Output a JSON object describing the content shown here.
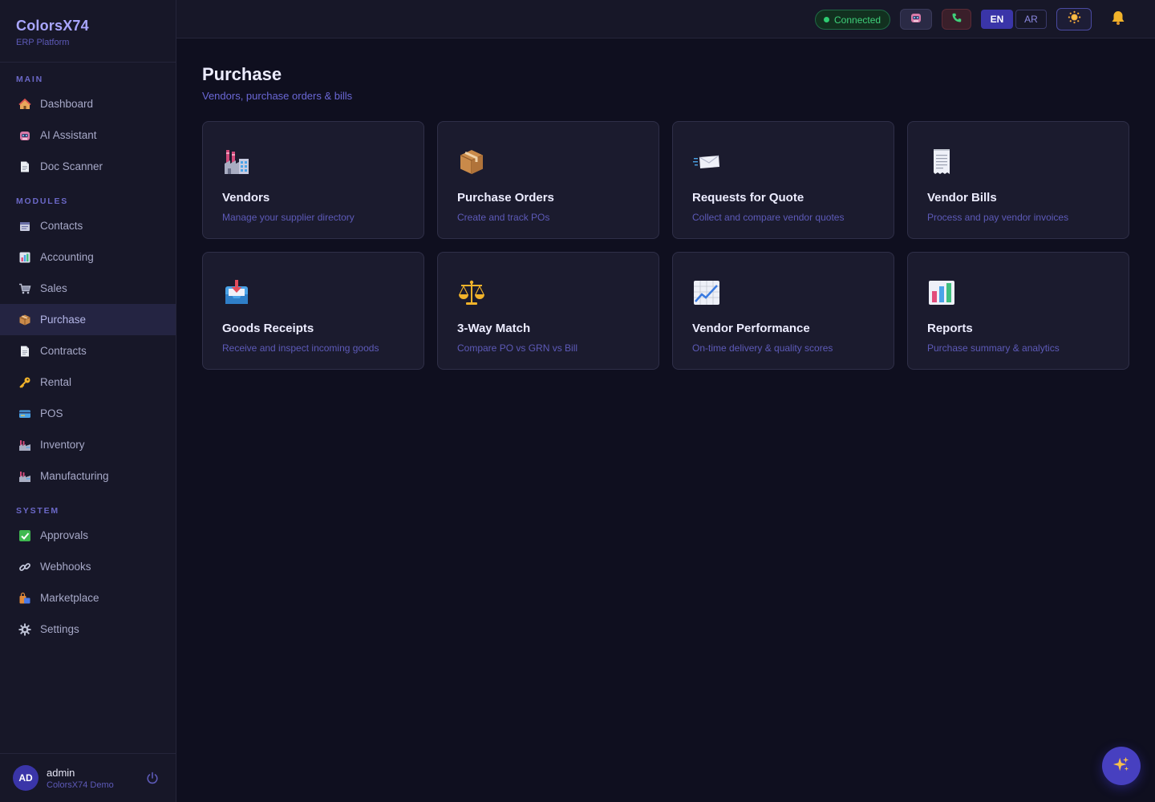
{
  "brand": {
    "name": "ColorsX74",
    "subtitle": "ERP Platform"
  },
  "sidebar": {
    "sections": {
      "main": "MAIN",
      "modules": "MODULES",
      "system": "SYSTEM"
    },
    "main_items": [
      {
        "label": "Dashboard",
        "icon": "house-icon"
      },
      {
        "label": "AI Assistant",
        "icon": "robot-icon"
      },
      {
        "label": "Doc Scanner",
        "icon": "document-icon"
      }
    ],
    "module_items": [
      {
        "label": "Contacts",
        "icon": "card-index-icon"
      },
      {
        "label": "Accounting",
        "icon": "bar-chart-icon"
      },
      {
        "label": "Sales",
        "icon": "cart-icon"
      },
      {
        "label": "Purchase",
        "icon": "package-icon",
        "active": true
      },
      {
        "label": "Contracts",
        "icon": "document-icon"
      },
      {
        "label": "Rental",
        "icon": "key-icon"
      },
      {
        "label": "POS",
        "icon": "credit-card-icon"
      },
      {
        "label": "Inventory",
        "icon": "factory-icon"
      },
      {
        "label": "Manufacturing",
        "icon": "factory-icon"
      }
    ],
    "system_items": [
      {
        "label": "Approvals",
        "icon": "check-box-icon"
      },
      {
        "label": "Webhooks",
        "icon": "link-icon"
      },
      {
        "label": "Marketplace",
        "icon": "shopping-bags-icon"
      },
      {
        "label": "Settings",
        "icon": "gear-icon"
      }
    ]
  },
  "user": {
    "initials": "AD",
    "name": "admin",
    "org": "ColorsX74 Demo"
  },
  "topbar": {
    "status": "Connected",
    "lang_en": "EN",
    "lang_ar": "AR"
  },
  "page": {
    "title": "Purchase",
    "subtitle": "Vendors, purchase orders & bills"
  },
  "cards": [
    {
      "title": "Vendors",
      "desc": "Manage your supplier directory",
      "icon": "factory-icon"
    },
    {
      "title": "Purchase Orders",
      "desc": "Create and track POs",
      "icon": "package-icon"
    },
    {
      "title": "Requests for Quote",
      "desc": "Collect and compare vendor quotes",
      "icon": "incoming-envelope-icon"
    },
    {
      "title": "Vendor Bills",
      "desc": "Process and pay vendor invoices",
      "icon": "receipt-icon"
    },
    {
      "title": "Goods Receipts",
      "desc": "Receive and inspect incoming goods",
      "icon": "inbox-tray-icon"
    },
    {
      "title": "3-Way Match",
      "desc": "Compare PO vs GRN vs Bill",
      "icon": "balance-scale-icon"
    },
    {
      "title": "Vendor Performance",
      "desc": "On-time delivery & quality scores",
      "icon": "chart-increasing-icon"
    },
    {
      "title": "Reports",
      "desc": "Purchase summary & analytics",
      "icon": "bar-chart-icon"
    }
  ],
  "colors": {
    "accent": "#4740c0",
    "connected": "#2ecc71",
    "sidebar_bg": "#171728",
    "page_bg": "#0f0f1f"
  }
}
